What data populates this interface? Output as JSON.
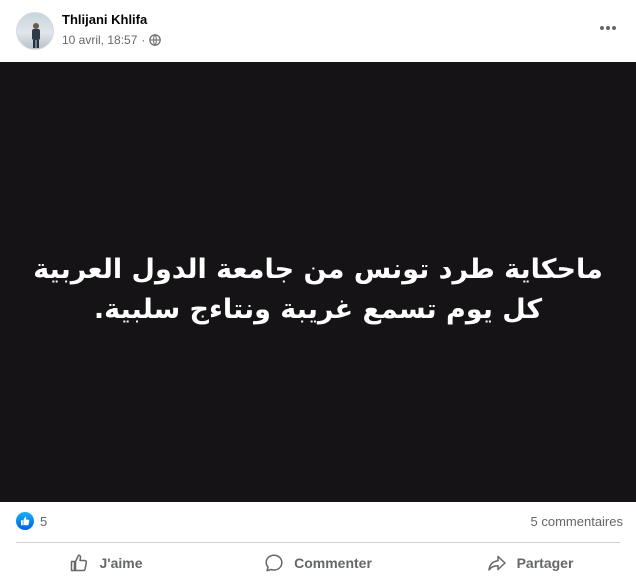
{
  "post": {
    "author": "Thlijani Khlifa",
    "timestamp": "10 avril, 18:57",
    "audience_icon": "globe-icon",
    "more_icon": "more-options-icon",
    "image_text": "ماحكاية طرد تونس من جامعة الدول العربية كل يوم تسمع غريبة ونتاءج سلبية.",
    "image_background": "#151315"
  },
  "stats": {
    "reaction_icon": "like-reaction-icon",
    "reactions_count": "5",
    "comments_count": "5 commentaires"
  },
  "actions": {
    "like_label": "J'aime",
    "comment_label": "Commenter",
    "share_label": "Partager"
  },
  "colors": {
    "accent": "#0866ff",
    "secondary_text": "#65676b"
  }
}
